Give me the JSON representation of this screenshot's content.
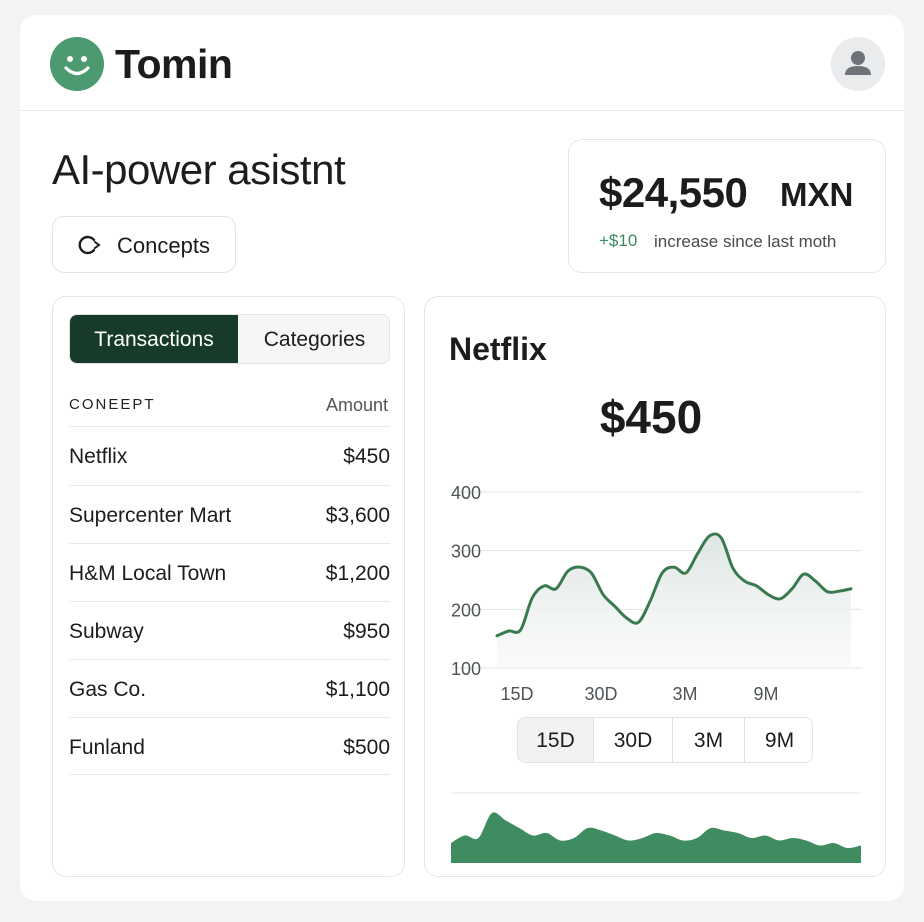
{
  "header": {
    "brand": "Tomin",
    "logo_icon": "smiley-icon",
    "avatar_icon": "user-icon"
  },
  "colors": {
    "accent": "#4c9a6f",
    "dark_green": "#173a2b",
    "positive": "#3d8a5f",
    "line": "#3a7a4f"
  },
  "page_title": "AI-power asistnt",
  "concepts_button": {
    "label": "Concepts",
    "icon": "refresh-icon"
  },
  "balance": {
    "amount": "$24,550",
    "currency": "MXN",
    "change": "+$10",
    "change_text": "increase since last moth"
  },
  "left_panel": {
    "tabs": [
      {
        "label": "Transactions",
        "active": true
      },
      {
        "label": "Categories",
        "active": false
      }
    ],
    "columns": {
      "concept": "CONEEPT",
      "amount": "Amount"
    },
    "rows": [
      {
        "name": "Netflix",
        "amount": "$450"
      },
      {
        "name": "Supercenter Mart",
        "amount": "$3,600"
      },
      {
        "name": "H&M Local Town",
        "amount": "$1,200"
      },
      {
        "name": "Subway",
        "amount": "$950"
      },
      {
        "name": "Gas Co.",
        "amount": "$1,100"
      },
      {
        "name": "Funland",
        "amount": "$500"
      }
    ]
  },
  "right_panel": {
    "title": "Netflix",
    "value": "$450",
    "range_buttons": [
      {
        "label": "15D",
        "selected": true
      },
      {
        "label": "30D",
        "selected": false
      },
      {
        "label": "3M",
        "selected": false
      },
      {
        "label": "9M",
        "selected": false
      }
    ]
  },
  "chart_data": [
    {
      "type": "area",
      "title": "",
      "xlabel": "",
      "ylabel": "",
      "y_ticks": [
        "400",
        "300",
        "200",
        "100"
      ],
      "x_ticks": [
        "15D",
        "30D",
        "3M",
        "9M"
      ],
      "ylim": [
        100,
        400
      ],
      "grid": true,
      "series": [
        {
          "values": [
            155,
            163,
            165,
            220,
            240,
            235,
            265,
            272,
            262,
            225,
            205,
            185,
            178,
            215,
            262,
            272,
            262,
            295,
            325,
            322,
            270,
            248,
            240,
            225,
            218,
            235,
            260,
            248,
            230,
            231,
            235
          ]
        }
      ]
    },
    {
      "type": "area",
      "title": "",
      "grid": false,
      "series": [
        {
          "values": [
            0.4,
            0.55,
            0.5,
            1.0,
            0.85,
            0.7,
            0.55,
            0.6,
            0.45,
            0.5,
            0.7,
            0.65,
            0.55,
            0.45,
            0.5,
            0.6,
            0.55,
            0.45,
            0.5,
            0.7,
            0.65,
            0.6,
            0.5,
            0.55,
            0.45,
            0.5,
            0.45,
            0.35,
            0.4,
            0.3,
            0.35
          ]
        }
      ]
    }
  ]
}
